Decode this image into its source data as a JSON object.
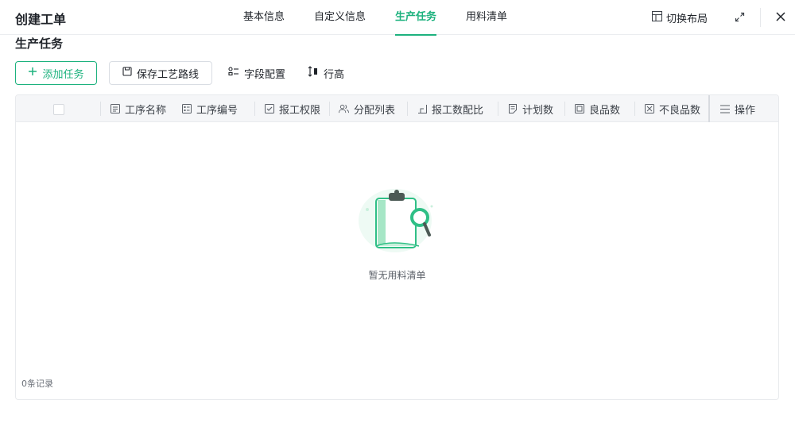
{
  "header": {
    "title": "创建工单",
    "tabs": [
      {
        "label": "基本信息",
        "active": false
      },
      {
        "label": "自定义信息",
        "active": false
      },
      {
        "label": "生产任务",
        "active": true
      },
      {
        "label": "用料清单",
        "active": false
      }
    ],
    "switch_layout_label": "切换布局",
    "icons": [
      "layout-icon",
      "expand-icon",
      "close-icon"
    ]
  },
  "section": {
    "title": "生产任务"
  },
  "toolbar": {
    "add_task_label": "添加任务",
    "save_route_label": "保存工艺路线",
    "field_config_label": "字段配置",
    "row_height_label": "行高"
  },
  "table": {
    "columns": [
      {
        "label": "工序名称",
        "icon": "text-field-icon"
      },
      {
        "label": "工序编号",
        "icon": "id-field-icon"
      },
      {
        "label": "报工权限",
        "icon": "checkbox-field-icon"
      },
      {
        "label": "分配列表",
        "icon": "users-icon"
      },
      {
        "label": "报工数配比",
        "icon": "ratio-icon"
      },
      {
        "label": "计划数",
        "icon": "plan-icon"
      },
      {
        "label": "良品数",
        "icon": "good-icon"
      },
      {
        "label": "不良品数",
        "icon": "defect-icon"
      },
      {
        "label": "操作",
        "icon": "list-icon"
      }
    ],
    "empty_text": "暂无用料清单",
    "record_count": "0条记录"
  },
  "colors": {
    "accent": "#1db27e",
    "border": "#e8eaed",
    "header_bg": "#f5f6f8"
  }
}
